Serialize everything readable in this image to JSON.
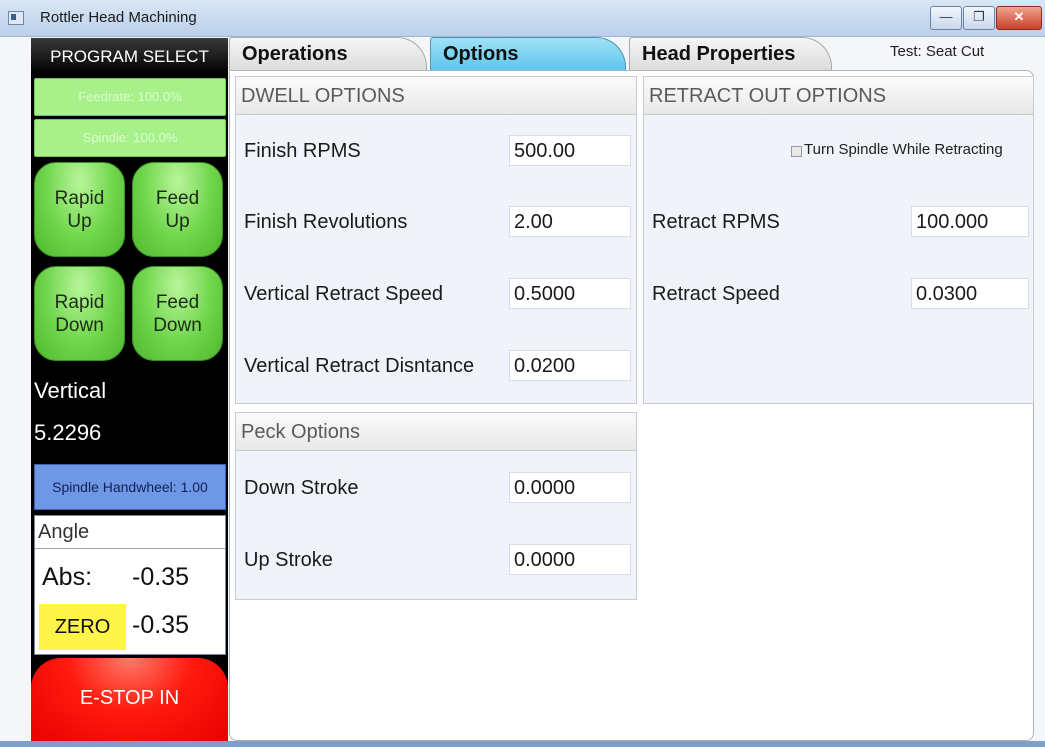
{
  "window": {
    "title": "Rottler Head Machining",
    "minimize_icon": "minimize-icon",
    "restore_icon": "restore-icon",
    "close_icon": "close-icon"
  },
  "sidebar": {
    "program_select": "PROGRAM SELECT",
    "feedrate": "Feedrate: 100.0%",
    "spindle": "Spindle: 100.0%",
    "rapid_up": "Rapid\nUp",
    "feed_up": "Feed\nUp",
    "rapid_down": "Rapid\nDown",
    "feed_down": "Feed\nDown",
    "vertical_label": "Vertical",
    "vertical_value": "5.2296",
    "spindle_handwheel": "Spindle Handwheel: 1.00",
    "angle_label": "Angle",
    "abs_label": "Abs:",
    "abs_value": "-0.35",
    "zero_label": "ZERO",
    "zero_value": "-0.35",
    "estop": "E-STOP IN"
  },
  "tabs": [
    {
      "label": "Operations"
    },
    {
      "label": "Options"
    },
    {
      "label": "Head Properties"
    }
  ],
  "active_tab": "Options",
  "test_label": "Test: Seat Cut",
  "dwell": {
    "header": "DWELL OPTIONS",
    "finish_rpms_label": "Finish RPMS",
    "finish_rpms_value": "500.00",
    "finish_revs_label": "Finish Revolutions",
    "finish_revs_value": "2.00",
    "vert_retract_speed_label": "Vertical Retract Speed",
    "vert_retract_speed_value": "0.5000",
    "vert_retract_dist_label": "Vertical Retract Disntance",
    "vert_retract_dist_value": "0.0200"
  },
  "retract": {
    "header": "RETRACT OUT OPTIONS",
    "turn_spindle_label": "Turn Spindle While Retracting",
    "turn_spindle_checked": false,
    "retract_rpms_label": "Retract RPMS",
    "retract_rpms_value": "100.000",
    "retract_speed_label": "Retract Speed",
    "retract_speed_value": "0.0300"
  },
  "peck": {
    "header": "Peck Options",
    "down_stroke_label": "Down Stroke",
    "down_stroke_value": "0.0000",
    "up_stroke_label": "Up Stroke",
    "up_stroke_value": "0.0000"
  },
  "colors": {
    "override_green": "#a7f08a",
    "jog_green": "#6fd64b",
    "handwheel_blue": "#6e98e6",
    "zero_yellow": "#fff44a",
    "estop_red": "#ff1a0e",
    "active_tab_cyan": "#5fc6ec"
  }
}
